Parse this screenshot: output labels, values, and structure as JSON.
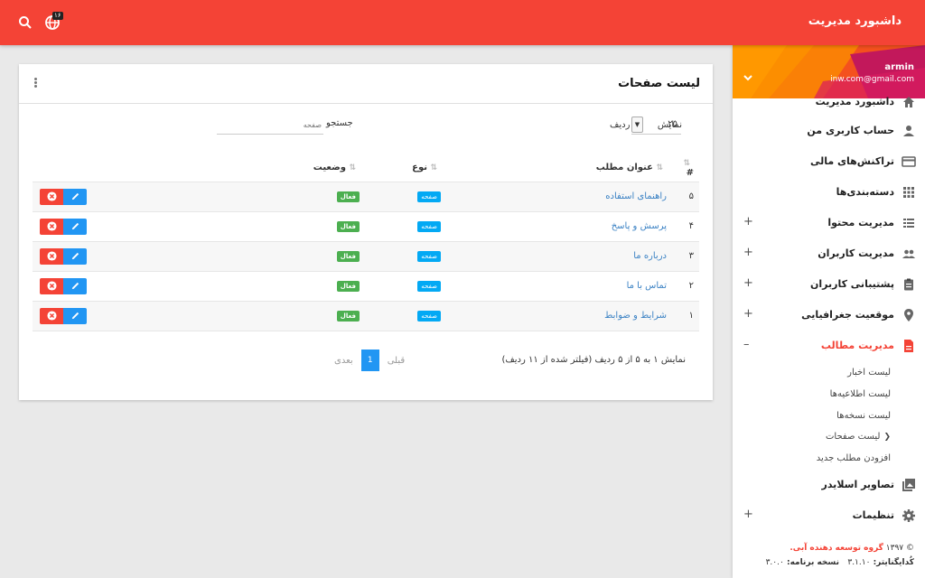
{
  "header": {
    "brand": "داشبورد مدیریت",
    "notification_count": "۱۶"
  },
  "profile": {
    "name": "armin",
    "email": "inw.com@gmail.com"
  },
  "sidebar": {
    "items": [
      {
        "label": "داشبورد مدیریت",
        "icon": "home-icon"
      },
      {
        "label": "حساب کاربری من",
        "icon": "person-icon"
      },
      {
        "label": "تراکنش‌های مالی",
        "icon": "credit-card-icon"
      },
      {
        "label": "دسته‌بندی‌ها",
        "icon": "grid-icon"
      },
      {
        "label": "مدیریت محتوا",
        "icon": "list-icon",
        "plus": "+"
      },
      {
        "label": "مدیریت کاربران",
        "icon": "people-icon",
        "plus": "+"
      },
      {
        "label": "پشتیبانی کاربران",
        "icon": "clipboard-icon",
        "plus": "+"
      },
      {
        "label": "موقعیت جغرافیایی",
        "icon": "location-pin-icon",
        "plus": "+"
      },
      {
        "label": "مدیریت مطالب",
        "icon": "document-icon",
        "plus": "–"
      },
      {
        "label": "تصاویر اسلایدر",
        "icon": "images-icon"
      },
      {
        "label": "تنظیمات",
        "icon": "gear-icon",
        "plus": "+"
      }
    ],
    "subitems": [
      "لیست اخبار",
      "لیست اطلاعیه‌ها",
      "لیست نسخه‌ها",
      "لیست صفحات",
      "افزودن مطلب جدید"
    ]
  },
  "footer": {
    "copyright": "© ۱۳۹۷",
    "org": "گروه توسعه دهنده آبی.",
    "coder_label": "کُدایگنایتر:",
    "coder_version": "۳.۱.۱۰",
    "app_label": "نسخه برنامه:",
    "app_version": "۳.۰.۰"
  },
  "card": {
    "title": "لیست صفحات",
    "length_label": "نمایش",
    "length_value": "۲۵",
    "length_suffix": "ردیف",
    "search_label": "جستجو",
    "search_placeholder": "صفحه"
  },
  "table": {
    "headers": {
      "num": "#",
      "title": "عنوان مطلب",
      "type": "نوع",
      "status": "وضعیت"
    },
    "rows": [
      {
        "num": "۵",
        "title": "راهنمای استفاده",
        "type": "صفحه",
        "status": "فعال"
      },
      {
        "num": "۴",
        "title": "پرسش و پاسخ",
        "type": "صفحه",
        "status": "فعال"
      },
      {
        "num": "۳",
        "title": "درباره ما",
        "type": "صفحه",
        "status": "فعال"
      },
      {
        "num": "۲",
        "title": "تماس با ما",
        "type": "صفحه",
        "status": "فعال"
      },
      {
        "num": "۱",
        "title": "شرایط و ضوابط",
        "type": "صفحه",
        "status": "فعال"
      }
    ]
  },
  "pagination": {
    "info": "نمایش ۱ به ۵ از ۵ ردیف (فیلتر شده از ۱۱ ردیف)",
    "prev": "قبلی",
    "current": "1",
    "next": "بعدی"
  },
  "colors": {
    "primary": "#f44336",
    "accent": "#2196f3",
    "tag_blue": "#03a9f4",
    "tag_green": "#4caf50"
  }
}
